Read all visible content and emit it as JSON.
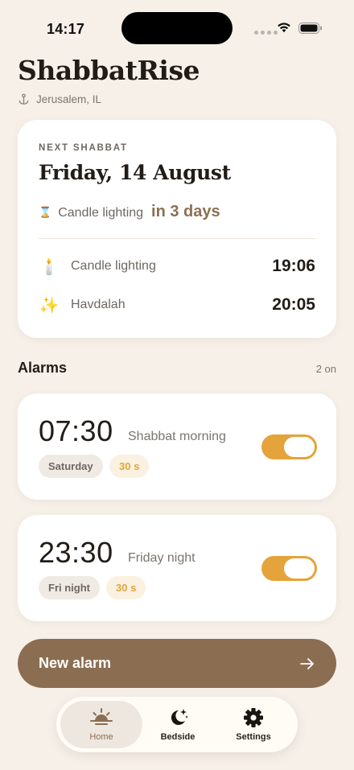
{
  "status_bar": {
    "time": "14:17"
  },
  "header": {
    "title": "ShabbatRise",
    "location": "Jerusalem, IL",
    "location_icon": "anchor-icon"
  },
  "shabbat": {
    "eyebrow": "NEXT SHABBAT",
    "date": "Friday, 14 August",
    "countdown_label": "Candle lighting",
    "countdown_value": "in 3 days",
    "countdown_icon": "hourglass-icon",
    "rows": [
      {
        "icon": "candle-icon",
        "emoji": "🕯️",
        "label": "Candle lighting",
        "time": "19:06"
      },
      {
        "icon": "sparkles-icon",
        "emoji": "✨",
        "label": "Havdalah",
        "time": "20:05"
      }
    ]
  },
  "alarms": {
    "heading": "Alarms",
    "count": "2 on",
    "items": [
      {
        "time": "07:30",
        "name": "Shabbat morning",
        "day": "Saturday",
        "duration": "30 s",
        "enabled": true
      },
      {
        "time": "23:30",
        "name": "Friday night",
        "day": "Fri night",
        "duration": "30 s",
        "enabled": true
      }
    ]
  },
  "new_alarm": {
    "label": "New alarm",
    "icon": "arrow-right-icon"
  },
  "tabs": [
    {
      "label": "Home",
      "icon": "sunrise-icon",
      "selected": true
    },
    {
      "label": "Bedside",
      "icon": "moon-stars-icon",
      "selected": false
    },
    {
      "label": "Settings",
      "icon": "gear-icon",
      "selected": false
    }
  ],
  "colors": {
    "background": "#f6f0e9",
    "accent_brown": "#8b6e52",
    "toggle_on": "#e5a33b",
    "chip_duration_text": "#e0a63c"
  }
}
